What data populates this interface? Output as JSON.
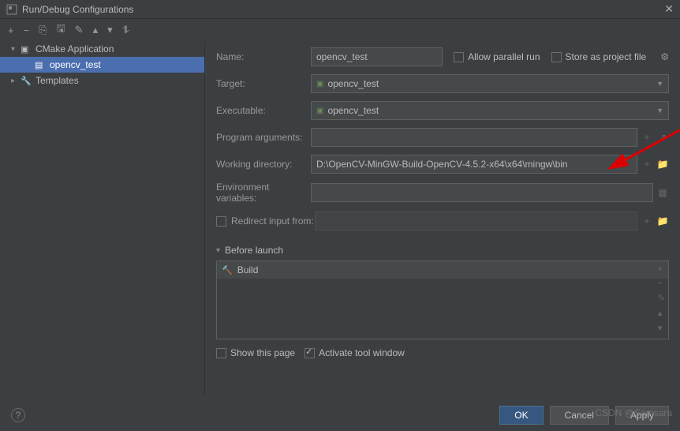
{
  "window": {
    "title": "Run/Debug Configurations"
  },
  "sidebar": {
    "root": "CMake Application",
    "selected": "opencv_test",
    "templates": "Templates"
  },
  "form": {
    "name_label": "Name:",
    "name_value": "opencv_test",
    "allow_parallel": "Allow parallel run",
    "store_as_project": "Store as project file",
    "target_label": "Target:",
    "target_value": "opencv_test",
    "executable_label": "Executable:",
    "executable_value": "opencv_test",
    "program_args_label": "Program arguments:",
    "program_args_value": "",
    "working_dir_label": "Working directory:",
    "working_dir_value": "D:\\OpenCV-MinGW-Build-OpenCV-4.5.2-x64\\x64\\mingw\\bin",
    "env_vars_label": "Environment variables:",
    "env_vars_value": "",
    "redirect_label": "Redirect input from:"
  },
  "before_launch": {
    "header": "Before launch",
    "item": "Build"
  },
  "bottom": {
    "show_this_page": "Show this page",
    "activate_tool": "Activate tool window"
  },
  "footer": {
    "ok": "OK",
    "cancel": "Cancel",
    "apply": "Apply"
  },
  "watermark": "CSDN @Samsara"
}
